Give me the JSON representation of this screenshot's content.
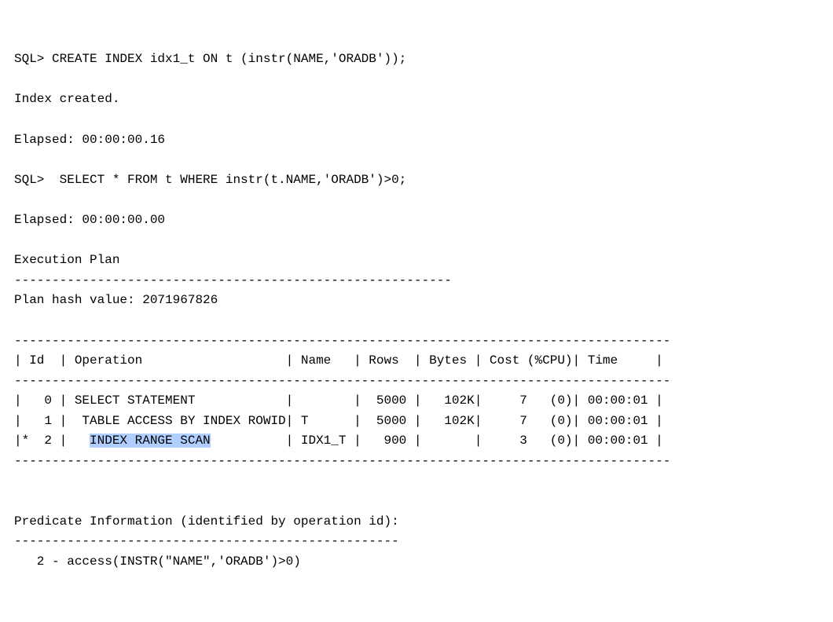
{
  "lines": {
    "l1": "SQL> CREATE INDEX idx1_t ON t (instr(NAME,'ORADB'));",
    "l2": "",
    "l3": "Index created.",
    "l4": "",
    "l5": "Elapsed: 00:00:00.16",
    "l6": "",
    "l7": "SQL>  SELECT * FROM t WHERE instr(t.NAME,'ORADB')>0;",
    "l8": "",
    "l9": "Elapsed: 00:00:00.00",
    "l10": "",
    "l11": "Execution Plan",
    "l12": "----------------------------------------------------------",
    "l13": "Plan hash value: 2071967826",
    "l14": "",
    "l15": "---------------------------------------------------------------------------------------",
    "l16": "| Id  | Operation                   | Name   | Rows  | Bytes | Cost (%CPU)| Time     |",
    "l17": "---------------------------------------------------------------------------------------",
    "l18": "|   0 | SELECT STATEMENT            |        |  5000 |   102K|     7   (0)| 00:00:01 |",
    "l19": "|   1 |  TABLE ACCESS BY INDEX ROWID| T      |  5000 |   102K|     7   (0)| 00:00:01 |",
    "l20a": "|*  2 |   ",
    "l20hl": "INDEX RANGE SCAN",
    "l20b": "          | IDX1_T |   900 |       |     3   (0)| 00:00:01 |",
    "l21": "---------------------------------------------------------------------------------------",
    "l22": "",
    "l23": "",
    "l24": "Predicate Information (identified by operation id):",
    "l25": "---------------------------------------------------",
    "l26": "   2 - access(INSTR(\"NAME\",'ORADB')>0)"
  },
  "chart_data": {
    "type": "table",
    "title": "Execution Plan",
    "plan_hash_value": 2071967826,
    "columns": [
      "Id",
      "Operation",
      "Name",
      "Rows",
      "Bytes",
      "Cost (%CPU)",
      "Time"
    ],
    "rows": [
      {
        "Id": "0",
        "Operation": "SELECT STATEMENT",
        "Name": "",
        "Rows": 5000,
        "Bytes": "102K",
        "Cost": "7   (0)",
        "Time": "00:00:01"
      },
      {
        "Id": "1",
        "Operation": "TABLE ACCESS BY INDEX ROWID",
        "Name": "T",
        "Rows": 5000,
        "Bytes": "102K",
        "Cost": "7   (0)",
        "Time": "00:00:01"
      },
      {
        "Id": "*  2",
        "Operation": "INDEX RANGE SCAN",
        "Name": "IDX1_T",
        "Rows": 900,
        "Bytes": "",
        "Cost": "3   (0)",
        "Time": "00:00:01"
      }
    ],
    "highlighted_operation": "INDEX RANGE SCAN",
    "predicate_information": "2 - access(INSTR(\"NAME\",'ORADB')>0)"
  }
}
